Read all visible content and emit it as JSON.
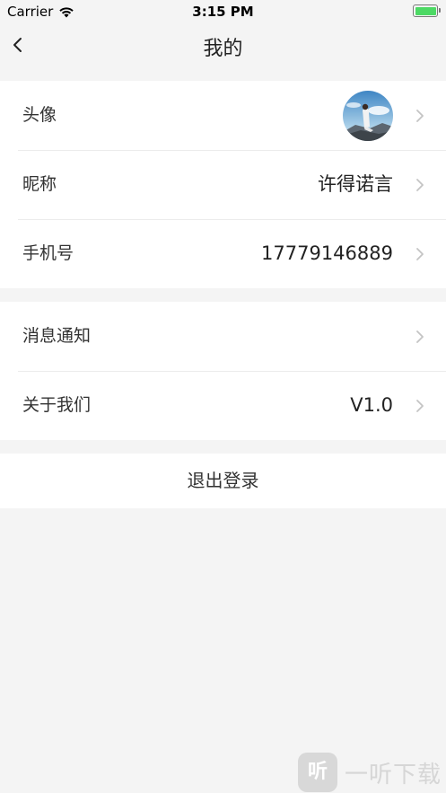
{
  "status_bar": {
    "carrier": "Carrier",
    "time": "3:15 PM"
  },
  "nav": {
    "title": "我的",
    "back_icon": "chevron-left-icon"
  },
  "profile": {
    "avatar_label": "头像",
    "nickname_label": "昵称",
    "nickname_value": "许得诺言",
    "phone_label": "手机号",
    "phone_value": "17779146889"
  },
  "settings": {
    "notifications_label": "消息通知",
    "about_label": "关于我们",
    "about_value": "V1.0"
  },
  "logout_label": "退出登录",
  "watermark": {
    "badge": "听",
    "text": "一听下载"
  },
  "colors": {
    "background": "#f4f4f4",
    "battery": "#4cd964",
    "chevron": "#c4c4c4"
  }
}
